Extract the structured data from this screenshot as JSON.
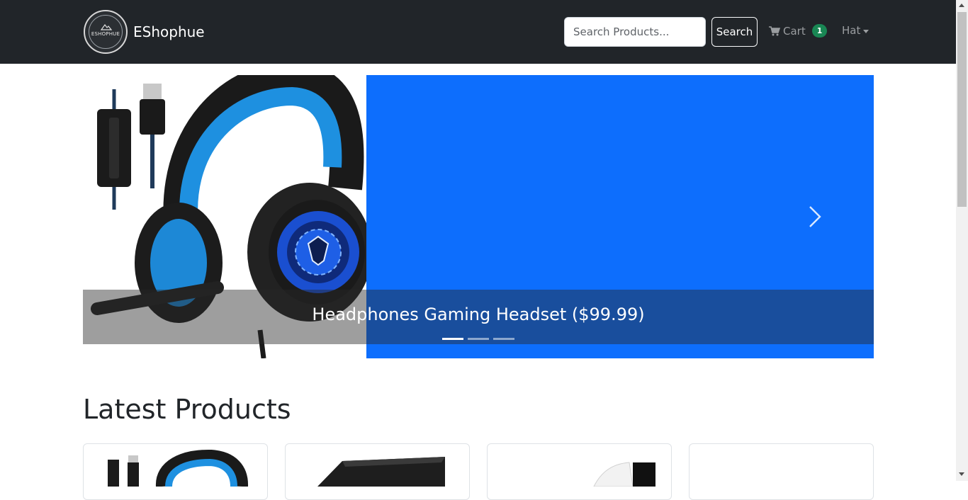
{
  "navbar": {
    "brand_name": "EShophue",
    "logo_text": "ESHOPHUE",
    "search_placeholder": "Search Products...",
    "search_button_label": "Search",
    "cart_label": "Cart",
    "cart_count": "1",
    "user_label": "Hat",
    "colors": {
      "background": "#212529",
      "badge": "#198754"
    }
  },
  "carousel": {
    "caption": "Headphones Gaming Headset ($99.99)",
    "slide_count": 3,
    "active_slide": 1,
    "panel_color": "#0d6efd",
    "next_icon": "chevron-right-icon"
  },
  "latest": {
    "title": "Latest Products",
    "cards": [
      {
        "image": "gaming-headset"
      },
      {
        "image": "desktop-pc"
      },
      {
        "image": "game-console"
      },
      {
        "image": "blank"
      }
    ]
  }
}
